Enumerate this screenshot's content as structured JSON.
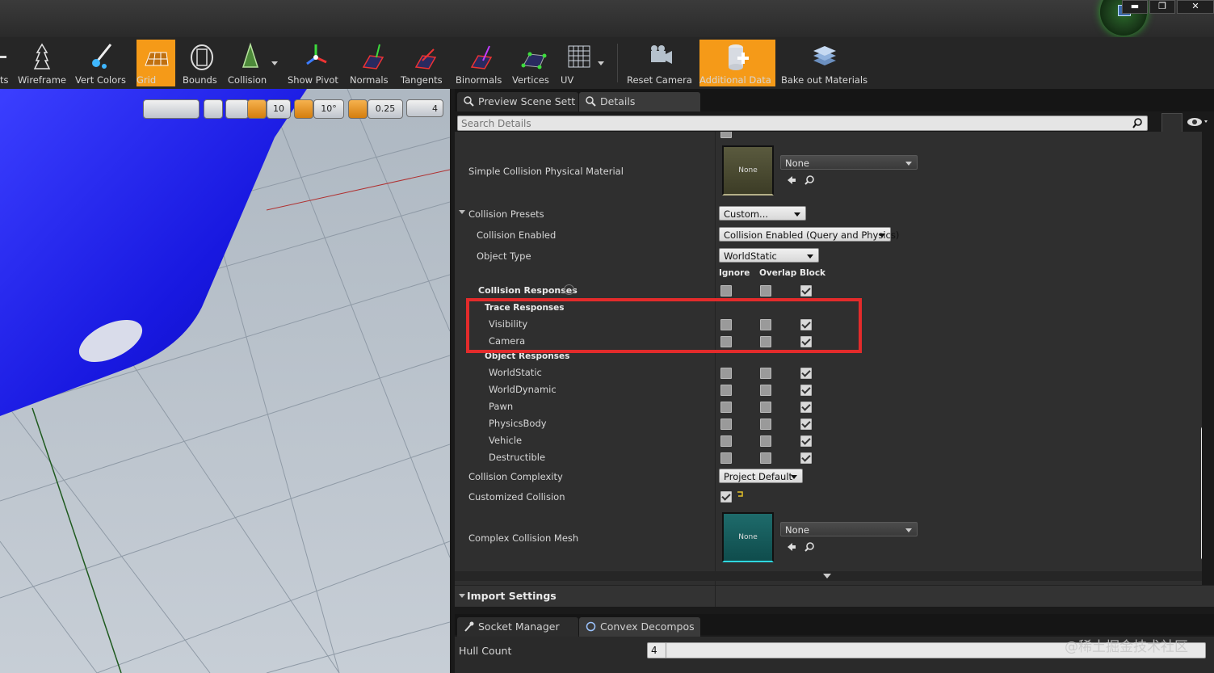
{
  "window": {
    "minimize_label": "▬",
    "restore_label": "❐",
    "close_label": "✕"
  },
  "toolbar": {
    "items": [
      {
        "label": "ts",
        "icon": "partial-icon"
      },
      {
        "label": "Wireframe",
        "icon": "wireframe-icon"
      },
      {
        "label": "Vert Colors",
        "icon": "vert-colors-icon"
      },
      {
        "label": "Grid",
        "icon": "grid-icon",
        "active": true
      },
      {
        "label": "Bounds",
        "icon": "bounds-icon"
      },
      {
        "label": "Collision",
        "icon": "collision-icon"
      },
      {
        "label": "Show Pivot",
        "icon": "pivot-icon"
      },
      {
        "label": "Normals",
        "icon": "normals-icon"
      },
      {
        "label": "Tangents",
        "icon": "tangents-icon"
      },
      {
        "label": "Binormals",
        "icon": "binormals-icon"
      },
      {
        "label": "Vertices",
        "icon": "vertices-icon"
      },
      {
        "label": "UV",
        "icon": "uv-icon"
      },
      {
        "label": "Reset Camera",
        "icon": "reset-camera-icon"
      },
      {
        "label": "Additional Data",
        "icon": "additional-data-icon",
        "active": true
      },
      {
        "label": "Bake out Materials",
        "icon": "bake-materials-icon"
      }
    ],
    "accent_color": "#f59a18"
  },
  "viewport": {
    "grid_snap": "10",
    "rotation_snap": "10°",
    "scale_snap": "0.25",
    "camera_speed": "4"
  },
  "tabs": {
    "preview": "Preview Scene Sett",
    "details": "Details"
  },
  "search": {
    "placeholder": "Search Details"
  },
  "details": {
    "simple_collision_label": "Simple Collision Physical Material",
    "simple_collision_value": "None",
    "simple_collision_thumb": "None",
    "collision_presets_label": "Collision Presets",
    "collision_presets_value": "Custom...",
    "collision_enabled_label": "Collision Enabled",
    "collision_enabled_value": "Collision Enabled (Query and Physics)",
    "object_type_label": "Object Type",
    "object_type_value": "WorldStatic",
    "col_ignore": "Ignore",
    "col_overlap": "Overlap",
    "col_block": "Block",
    "collision_responses_label": "Collision Responses",
    "trace_responses_label": "Trace Responses",
    "object_responses_label": "Object Responses",
    "trace_rows": [
      {
        "label": "Visibility",
        "ignore": false,
        "overlap": false,
        "block": true
      },
      {
        "label": "Camera",
        "ignore": false,
        "overlap": false,
        "block": true
      }
    ],
    "object_rows": [
      {
        "label": "WorldStatic",
        "ignore": false,
        "overlap": false,
        "block": true
      },
      {
        "label": "WorldDynamic",
        "ignore": false,
        "overlap": false,
        "block": true
      },
      {
        "label": "Pawn",
        "ignore": false,
        "overlap": false,
        "block": true
      },
      {
        "label": "PhysicsBody",
        "ignore": false,
        "overlap": false,
        "block": true
      },
      {
        "label": "Vehicle",
        "ignore": false,
        "overlap": false,
        "block": true
      },
      {
        "label": "Destructible",
        "ignore": false,
        "overlap": false,
        "block": true
      }
    ],
    "collision_complexity_label": "Collision Complexity",
    "collision_complexity_value": "Project Default",
    "customized_collision_label": "Customized Collision",
    "customized_collision_checked": true,
    "complex_mesh_label": "Complex Collision Mesh",
    "complex_mesh_value": "None",
    "complex_mesh_thumb": "None"
  },
  "import_settings": "Import Settings",
  "bottom_tabs": {
    "socket": "Socket Manager",
    "convex": "Convex Decompos"
  },
  "hull": {
    "label": "Hull Count",
    "value": "4"
  },
  "watermark": "@稀土掘金技术社区"
}
